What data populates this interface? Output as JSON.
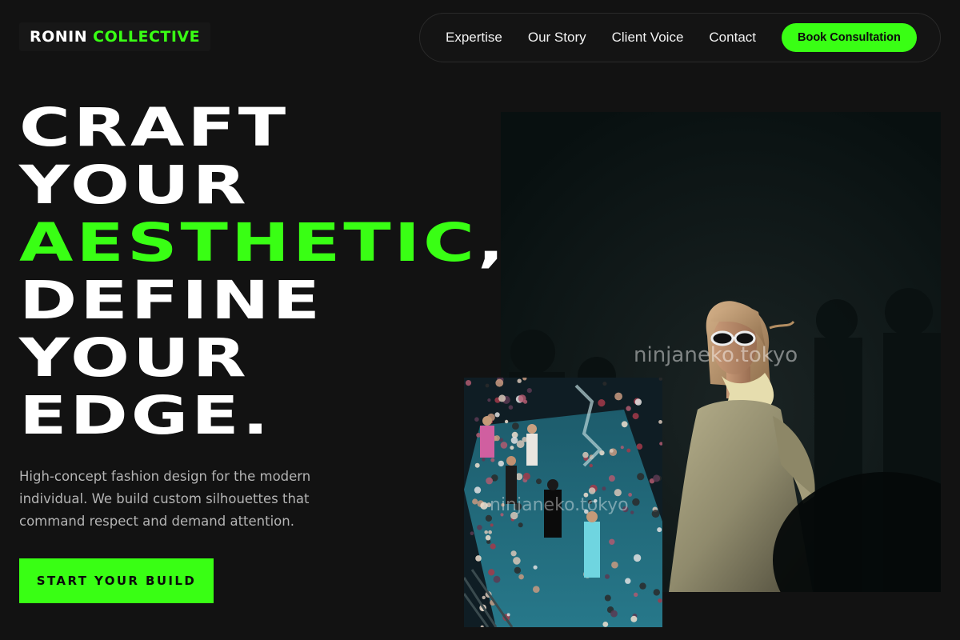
{
  "brand": {
    "word1": "RONIN",
    "word2": "COLLECTIVE"
  },
  "nav": {
    "items": [
      "Expertise",
      "Our Story",
      "Client Voice",
      "Contact"
    ],
    "cta_label": "Book Consultation"
  },
  "hero": {
    "lines": [
      "CRAFT",
      "YOUR",
      "AESTHETIC",
      "DEFINE",
      "YOUR",
      "EDGE."
    ],
    "comma": ",",
    "description": [
      "High-concept fashion design for the modern",
      "individual. We build custom silhouettes that",
      "command respect and demand attention."
    ],
    "button_label": "START YOUR BUILD"
  },
  "images": {
    "model_watermark": "ninjaneko.tokyo",
    "runway_watermark": "ninjaneko.tokyo"
  },
  "colors": {
    "accent": "#39ff14",
    "background": "#121212",
    "text": "#ffffff",
    "muted": "#b4b4b4"
  }
}
